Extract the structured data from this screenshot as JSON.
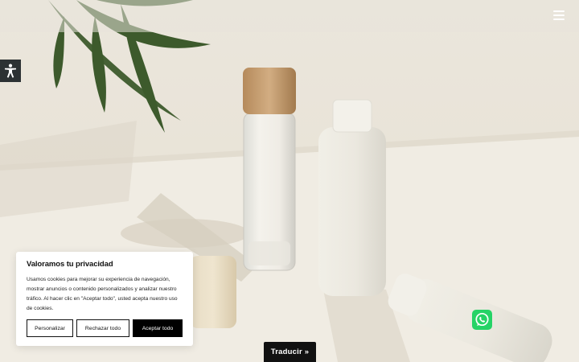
{
  "header": {
    "menu_icon": "hamburger-menu-icon"
  },
  "accessibility": {
    "icon": "accessibility-icon"
  },
  "hero": {
    "image_description": "cosmetic-bottles-product-photo"
  },
  "cookie_banner": {
    "title": "Valoramos tu privacidad",
    "body": "Usamos cookies para mejorar su experiencia de navegación, mostrar anuncios o contenido personalizados y analizar nuestro tráfico. Al hacer clic en \"Aceptar todo\", usted acepta nuestro uso de cookies.",
    "customize_label": "Personalizar",
    "reject_label": "Rechazar todo",
    "accept_label": "Aceptar todo"
  },
  "whatsapp": {
    "icon": "whatsapp-icon",
    "color": "#25d366"
  },
  "translate": {
    "label": "Traducir »"
  },
  "colors": {
    "background": "#ece7dd",
    "dark": "#111111"
  }
}
